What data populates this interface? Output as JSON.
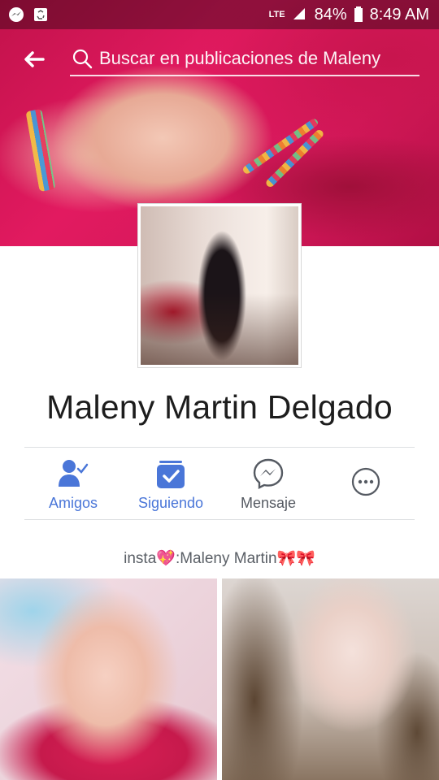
{
  "status_bar": {
    "network": "LTE",
    "battery": "84%",
    "time": "8:49 AM"
  },
  "header": {
    "search_placeholder": "Buscar en publicaciones de Maleny"
  },
  "profile": {
    "name": "Maleny Martin Delgado",
    "bio_prefix": "insta",
    "bio_heart": "💖",
    "bio_suffix": ":Maleny Martin",
    "bio_ribbons": "🎀🎀"
  },
  "actions": [
    {
      "label": "Amigos",
      "icon": "friends-check-icon",
      "color": "#4a76d8"
    },
    {
      "label": "Siguiendo",
      "icon": "following-check-icon",
      "color": "#4a76d8"
    },
    {
      "label": "Mensaje",
      "icon": "messenger-icon",
      "color": "#555a62"
    },
    {
      "label": "",
      "icon": "more-icon",
      "color": "#555a62"
    }
  ],
  "colors": {
    "accent_blue": "#4a76d8",
    "text_dark": "#1d1d1d",
    "divider": "#dddfe2"
  }
}
